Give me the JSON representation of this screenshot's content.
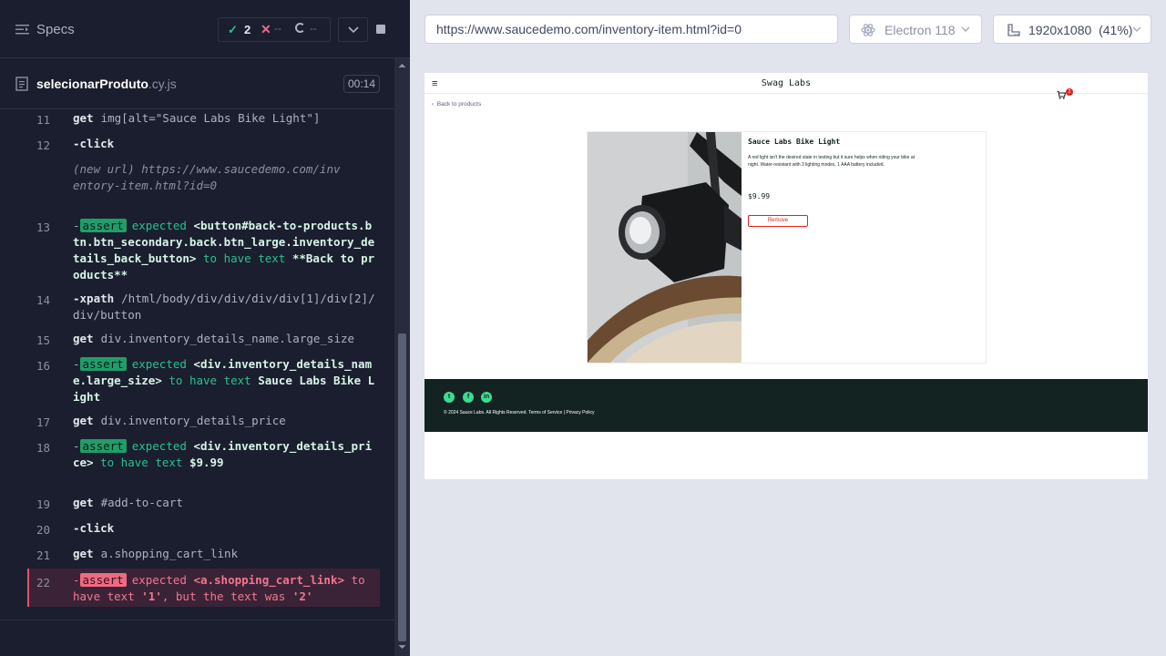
{
  "specs": {
    "title": "Specs",
    "passed": "2",
    "failed": "--",
    "pending": "--"
  },
  "file": {
    "name": "selecionarProduto",
    "ext": ".cy.js",
    "duration": "00:14"
  },
  "log": [
    {
      "n": "11",
      "name": "get",
      "arg": "img[alt=\"Sauce Labs Bike Light\"]"
    },
    {
      "n": "12",
      "name": "-click"
    },
    {
      "new_label": "(new url)",
      "url": "https://www.saucedemo.com/inventory-item.html?id=0"
    },
    {
      "n": "13",
      "badge": "assert",
      "expected": "expected",
      "subject": "<button#back-to-products.btn.btn_secondary.back.btn_large.inventory_details_back_button>",
      "rel": "to have text",
      "value": "**Back to products**"
    },
    {
      "n": "14",
      "name": "-xpath",
      "arg": "/html/body/div/div/div/div[1]/div[2]/div/button"
    },
    {
      "n": "15",
      "name": "get",
      "arg": "div.inventory_details_name.large_size"
    },
    {
      "n": "16",
      "badge": "assert",
      "expected": "expected",
      "subject": "<div.inventory_details_name.large_size>",
      "rel": "to have text",
      "value": "Sauce Labs Bike Light"
    },
    {
      "n": "17",
      "name": "get",
      "arg": "div.inventory_details_price"
    },
    {
      "n": "18",
      "badge": "assert",
      "expected": "expected",
      "subject": "<div.inventory_details_price>",
      "rel": "to have text",
      "value": "$9.99"
    },
    {
      "n": "19",
      "name": "get",
      "arg": "#add-to-cart"
    },
    {
      "n": "20",
      "name": "-click"
    },
    {
      "n": "21",
      "name": "get",
      "arg": "a.shopping_cart_link"
    },
    {
      "n": "22",
      "badge": "assert",
      "expected": "expected",
      "subject": "<a.shopping_cart_link>",
      "rel": "to have text",
      "value": "'1'",
      "but": ", but the text was",
      "actual": "'2'"
    }
  ],
  "browser": {
    "url": "https://www.saucedemo.com/inventory-item.html?id=0",
    "engine": "Electron 118",
    "viewport": "1920x1080",
    "zoom": "(41%)"
  },
  "app": {
    "menu_icon": "≡",
    "logo": "Swag Labs",
    "cart_count": "2",
    "back_label": "Back to products",
    "product_name": "Sauce Labs Bike Light",
    "product_desc": "A red light isn't the desired state in testing but it sure helps when riding your bike at night. Water-resistant with 3 lighting modes, 1 AAA battery included.",
    "product_price": "$9.99",
    "remove_label": "Remove",
    "footer_text": "© 2024 Sauce Labs. All Rights Reserved. Terms of Service | Privacy Policy",
    "social": [
      "t",
      "f",
      "in"
    ]
  },
  "colors": {
    "pass": "#26c28f",
    "fail": "#f06b82",
    "footer_bg": "#132322",
    "remove": "#e2231a"
  }
}
